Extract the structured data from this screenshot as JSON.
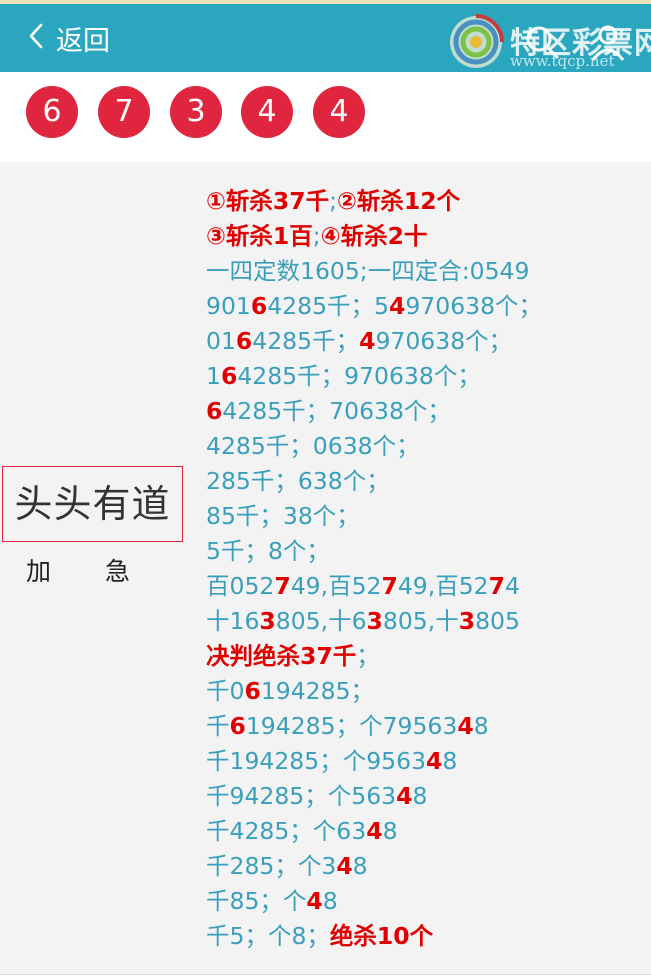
{
  "header": {
    "back_label": "返回",
    "logo_text": "特区彩票网",
    "logo_url": "www.tqcp.net"
  },
  "balls": [
    "6",
    "7",
    "3",
    "4",
    "4"
  ],
  "colors": {
    "header_bg": "#2aa7bf",
    "ball_bg": "#e0263f",
    "text": "#3a9fbc",
    "highlight": "#e00000"
  },
  "sidebar": {
    "title": "头头有道",
    "tag_left": "加",
    "tag_right": "急"
  },
  "lines": [
    [
      {
        "t": "①斩杀37千",
        "c": "r"
      },
      {
        "t": ";",
        "c": "n"
      },
      {
        "t": "②斩杀12个",
        "c": "r"
      }
    ],
    [
      {
        "t": "③斩杀1百",
        "c": "r"
      },
      {
        "t": ";",
        "c": "n"
      },
      {
        "t": "④斩杀2十",
        "c": "r"
      }
    ],
    [
      {
        "t": "一四定数1605;一四定合:0549",
        "c": "n"
      }
    ],
    [
      {
        "t": "901",
        "c": "n"
      },
      {
        "t": "6",
        "c": "r"
      },
      {
        "t": "4285千；5",
        "c": "n"
      },
      {
        "t": "4",
        "c": "r"
      },
      {
        "t": "970638个；",
        "c": "n"
      }
    ],
    [
      {
        "t": "01",
        "c": "n"
      },
      {
        "t": "6",
        "c": "r"
      },
      {
        "t": "4285千；",
        "c": "n"
      },
      {
        "t": "4",
        "c": "r"
      },
      {
        "t": "970638个；",
        "c": "n"
      }
    ],
    [
      {
        "t": "1",
        "c": "n"
      },
      {
        "t": "6",
        "c": "r"
      },
      {
        "t": "4285千；970638个；",
        "c": "n"
      }
    ],
    [
      {
        "t": "6",
        "c": "r"
      },
      {
        "t": "4285千；70638个；",
        "c": "n"
      }
    ],
    [
      {
        "t": "4285千；0638个；",
        "c": "n"
      }
    ],
    [
      {
        "t": "285千；638个；",
        "c": "n"
      }
    ],
    [
      {
        "t": "85千；38个；",
        "c": "n"
      }
    ],
    [
      {
        "t": "5千；8个；",
        "c": "n"
      }
    ],
    [
      {
        "t": "百052",
        "c": "n"
      },
      {
        "t": "7",
        "c": "r"
      },
      {
        "t": "49,百52",
        "c": "n"
      },
      {
        "t": "7",
        "c": "r"
      },
      {
        "t": "49,百52",
        "c": "n"
      },
      {
        "t": "7",
        "c": "r"
      },
      {
        "t": "4",
        "c": "n"
      }
    ],
    [
      {
        "t": "十16",
        "c": "n"
      },
      {
        "t": "3",
        "c": "r"
      },
      {
        "t": "805,十6",
        "c": "n"
      },
      {
        "t": "3",
        "c": "r"
      },
      {
        "t": "805,十",
        "c": "n"
      },
      {
        "t": "3",
        "c": "r"
      },
      {
        "t": "805",
        "c": "n"
      }
    ],
    [
      {
        "t": "决判绝杀37千",
        "c": "r"
      },
      {
        "t": "；",
        "c": "n"
      }
    ],
    [
      {
        "t": "千0",
        "c": "n"
      },
      {
        "t": "6",
        "c": "r"
      },
      {
        "t": "194285；",
        "c": "n"
      }
    ],
    [
      {
        "t": "千",
        "c": "n"
      },
      {
        "t": "6",
        "c": "r"
      },
      {
        "t": "194285；个79563",
        "c": "n"
      },
      {
        "t": "4",
        "c": "r"
      },
      {
        "t": "8",
        "c": "n"
      }
    ],
    [
      {
        "t": "千194285；个9563",
        "c": "n"
      },
      {
        "t": "4",
        "c": "r"
      },
      {
        "t": "8",
        "c": "n"
      }
    ],
    [
      {
        "t": "千94285；个563",
        "c": "n"
      },
      {
        "t": "4",
        "c": "r"
      },
      {
        "t": "8",
        "c": "n"
      }
    ],
    [
      {
        "t": "千4285；个63",
        "c": "n"
      },
      {
        "t": "4",
        "c": "r"
      },
      {
        "t": "8",
        "c": "n"
      }
    ],
    [
      {
        "t": "千285；个3",
        "c": "n"
      },
      {
        "t": "4",
        "c": "r"
      },
      {
        "t": "8",
        "c": "n"
      }
    ],
    [
      {
        "t": "千85；个",
        "c": "n"
      },
      {
        "t": "4",
        "c": "r"
      },
      {
        "t": "8",
        "c": "n"
      }
    ],
    [
      {
        "t": "千5；个8；",
        "c": "n"
      },
      {
        "t": "绝杀10个",
        "c": "r"
      }
    ]
  ]
}
